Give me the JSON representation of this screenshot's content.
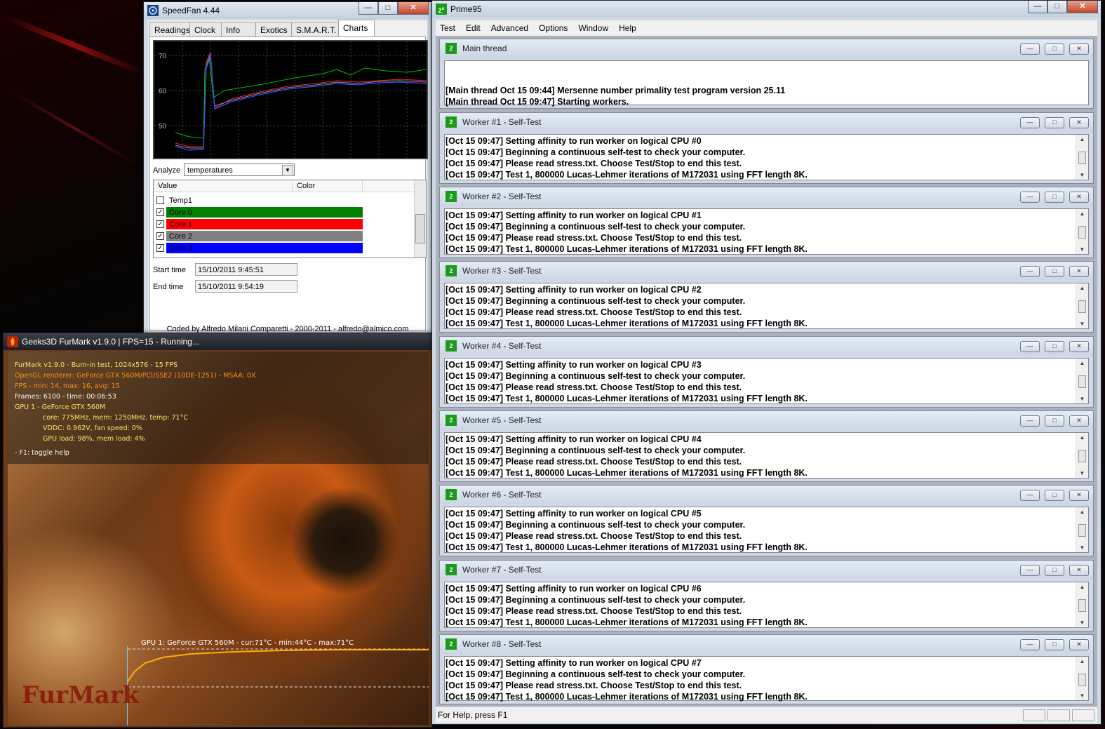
{
  "speedfan": {
    "title": "SpeedFan 4.44",
    "tabs": [
      "Readings",
      "Clock",
      "Info",
      "Exotics",
      "S.M.A.R.T.",
      "Charts"
    ],
    "active_tab": "Charts",
    "chart_ticks": [
      "70",
      "60",
      "50"
    ],
    "analyze_label": "Analyze",
    "analyze_value": "temperatures",
    "list_headers": [
      "Value",
      "Color"
    ],
    "list_rows": [
      {
        "label": "Temp1",
        "checked": false,
        "color": ""
      },
      {
        "label": "Core 0",
        "checked": true,
        "color": "#008000"
      },
      {
        "label": "Core 1",
        "checked": true,
        "color": "#ff0000"
      },
      {
        "label": "Core 2",
        "checked": true,
        "color": "#808080"
      },
      {
        "label": "Core 3",
        "checked": true,
        "color": "#0000ff"
      }
    ],
    "start_label": "Start time",
    "start_value": "15/10/2011 9:45:51",
    "end_label": "End time",
    "end_value": "15/10/2011 9:54:19",
    "footer": "Coded by Alfredo Milani Comparetti - 2000-2011 - alfredo@almico.com"
  },
  "furmark": {
    "title": "Geeks3D FurMark v1.9.0 | FPS=15 - Running...",
    "hud": [
      "FurMark v1.9.0 - Burn-in test, 1024x576 - 15 FPS",
      "OpenGL renderer: GeForce GTX 560M/PCI/SSE2 (10DE-1251) - MSAA: 0X",
      "FPS - min: 14, max: 16, avg: 15",
      "Frames: 6100 - time: 00:06:53",
      "GPU 1 - GeForce GTX 560M",
      "core: 775MHz, mem: 1250MHz, temp: 71°C",
      "VDDC: 0.962V, fan speed: 0%",
      "GPU load: 98%, mem load: 4%",
      "- F1: toggle help"
    ],
    "graph_label": "GPU 1: GeForce GTX 560M - cur:71°C - min:44°C - max:71°C",
    "logo_text": "FurMark"
  },
  "prime": {
    "title": "Prime95",
    "menu": [
      "Test",
      "Edit",
      "Advanced",
      "Options",
      "Window",
      "Help"
    ],
    "main_thread": {
      "title": "Main thread",
      "lines": [
        "[Main thread Oct 15 09:44] Mersenne number primality test program version 25.11",
        "[Main thread Oct 15 09:47] Starting workers."
      ]
    },
    "workers": [
      {
        "title": "Worker #1 - Self-Test",
        "lines": [
          "[Oct 15 09:47] Setting affinity to run worker on logical CPU #0",
          "[Oct 15 09:47] Beginning a continuous self-test to check your computer.",
          "[Oct 15 09:47] Please read stress.txt.  Choose Test/Stop to end this test.",
          "[Oct 15 09:47] Test 1, 800000 Lucas-Lehmer iterations of M172031 using FFT length 8K."
        ]
      },
      {
        "title": "Worker #2 - Self-Test",
        "lines": [
          "[Oct 15 09:47] Setting affinity to run worker on logical CPU #1",
          "[Oct 15 09:47] Beginning a continuous self-test to check your computer.",
          "[Oct 15 09:47] Please read stress.txt.  Choose Test/Stop to end this test.",
          "[Oct 15 09:47] Test 1, 800000 Lucas-Lehmer iterations of M172031 using FFT length 8K."
        ]
      },
      {
        "title": "Worker #3 - Self-Test",
        "lines": [
          "[Oct 15 09:47] Setting affinity to run worker on logical CPU #2",
          "[Oct 15 09:47] Beginning a continuous self-test to check your computer.",
          "[Oct 15 09:47] Please read stress.txt.  Choose Test/Stop to end this test.",
          "[Oct 15 09:47] Test 1, 800000 Lucas-Lehmer iterations of M172031 using FFT length 8K."
        ]
      },
      {
        "title": "Worker #4 - Self-Test",
        "lines": [
          "[Oct 15 09:47] Setting affinity to run worker on logical CPU #3",
          "[Oct 15 09:47] Beginning a continuous self-test to check your computer.",
          "[Oct 15 09:47] Please read stress.txt.  Choose Test/Stop to end this test.",
          "[Oct 15 09:47] Test 1, 800000 Lucas-Lehmer iterations of M172031 using FFT length 8K."
        ]
      },
      {
        "title": "Worker #5 - Self-Test",
        "lines": [
          "[Oct 15 09:47] Setting affinity to run worker on logical CPU #4",
          "[Oct 15 09:47] Beginning a continuous self-test to check your computer.",
          "[Oct 15 09:47] Please read stress.txt.  Choose Test/Stop to end this test.",
          "[Oct 15 09:47] Test 1, 800000 Lucas-Lehmer iterations of M172031 using FFT length 8K."
        ]
      },
      {
        "title": "Worker #6 - Self-Test",
        "lines": [
          "[Oct 15 09:47] Setting affinity to run worker on logical CPU #5",
          "[Oct 15 09:47] Beginning a continuous self-test to check your computer.",
          "[Oct 15 09:47] Please read stress.txt.  Choose Test/Stop to end this test.",
          "[Oct 15 09:47] Test 1, 800000 Lucas-Lehmer iterations of M172031 using FFT length 8K."
        ]
      },
      {
        "title": "Worker #7 - Self-Test",
        "lines": [
          "[Oct 15 09:47] Setting affinity to run worker on logical CPU #6",
          "[Oct 15 09:47] Beginning a continuous self-test to check your computer.",
          "[Oct 15 09:47] Please read stress.txt.  Choose Test/Stop to end this test.",
          "[Oct 15 09:47] Test 1, 800000 Lucas-Lehmer iterations of M172031 using FFT length 8K."
        ]
      },
      {
        "title": "Worker #8 - Self-Test",
        "lines": [
          "[Oct 15 09:47] Setting affinity to run worker on logical CPU #7",
          "[Oct 15 09:47] Beginning a continuous self-test to check your computer.",
          "[Oct 15 09:47] Please read stress.txt.  Choose Test/Stop to end this test.",
          "[Oct 15 09:47] Test 1, 800000 Lucas-Lehmer iterations of M172031 using FFT length 8K."
        ]
      }
    ],
    "status": "For Help, press F1"
  }
}
